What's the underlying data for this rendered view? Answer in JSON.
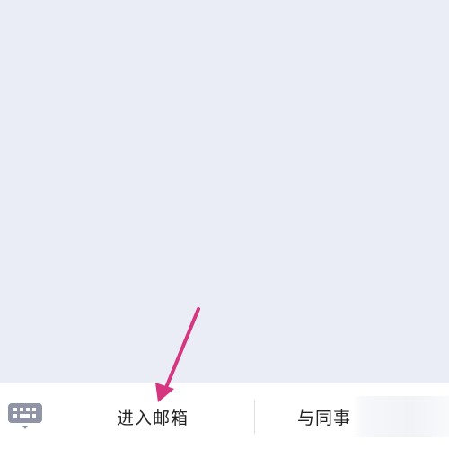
{
  "bottom_menu": {
    "items": [
      {
        "label": "进入邮箱"
      },
      {
        "label": "与同事"
      }
    ]
  },
  "icons": {
    "keyboard_toggle": "keyboard-icon",
    "annotation": "arrow-icon"
  },
  "colors": {
    "chat_background": "#eaedf5",
    "bar_background": "#ffffff",
    "keyboard_icon": "#8f95a6",
    "annotation_arrow": "#d6357f",
    "text": "#222222"
  }
}
